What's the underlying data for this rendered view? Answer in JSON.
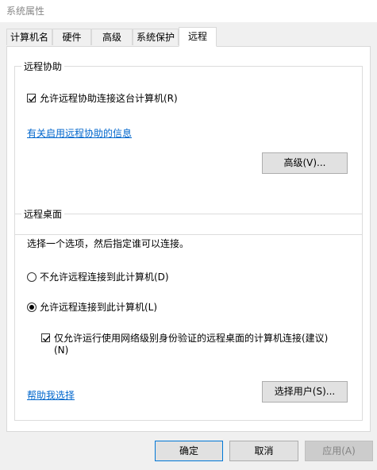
{
  "window": {
    "title": "系统属性"
  },
  "tabs": [
    {
      "label": "计算机名"
    },
    {
      "label": "硬件"
    },
    {
      "label": "高级"
    },
    {
      "label": "系统保护"
    },
    {
      "label": "远程"
    }
  ],
  "remote_assistance": {
    "legend": "远程协助",
    "allow_label": "允许远程协助连接这台计算机(R)",
    "allow_checked": true,
    "info_link": "有关启用远程协助的信息",
    "advanced_button": "高级(V)..."
  },
  "remote_desktop": {
    "legend": "远程桌面",
    "instruction": "选择一个选项，然后指定谁可以连接。",
    "option_deny": "不允许远程连接到此计算机(D)",
    "option_allow": "允许远程连接到此计算机(L)",
    "selected": "allow",
    "nla_label_line1": "仅允许运行使用网络级别身份验证的远程桌面的计算机连接(建议)",
    "nla_label_line2": "(N)",
    "nla_checked": true,
    "help_link": "帮助我选择",
    "select_users_button": "选择用户(S)..."
  },
  "footer": {
    "ok": "确定",
    "cancel": "取消",
    "apply": "应用(A)"
  }
}
